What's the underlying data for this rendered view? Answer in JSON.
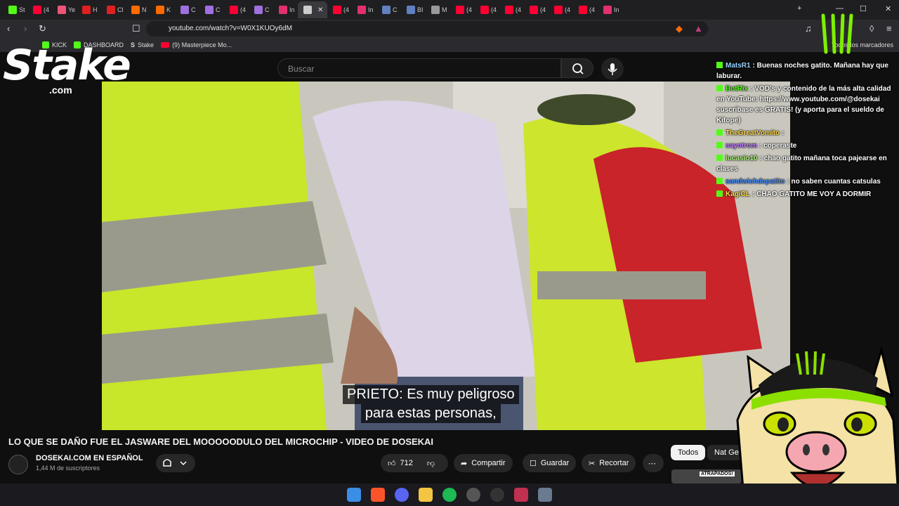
{
  "browser": {
    "tabs": [
      {
        "label": "St",
        "color": "#53fc18"
      },
      {
        "label": "(4",
        "color": "#ff0033"
      },
      {
        "label": "Ye",
        "color": "#ee5577"
      },
      {
        "label": "H",
        "color": "#e02020"
      },
      {
        "label": "Cl",
        "color": "#e02020"
      },
      {
        "label": "N",
        "color": "#ff6a00"
      },
      {
        "label": "K",
        "color": "#ff6a00"
      },
      {
        "label": "C",
        "color": "#a070e0"
      },
      {
        "label": "C",
        "color": "#a070e0"
      },
      {
        "label": "(4",
        "color": "#ff0033"
      },
      {
        "label": "C",
        "color": "#a070e0"
      },
      {
        "label": "In",
        "color": "#e1306c"
      },
      {
        "label": "",
        "color": "#cccccc",
        "active": true
      },
      {
        "label": "(4",
        "color": "#ff0033"
      },
      {
        "label": "In",
        "color": "#e1306c"
      },
      {
        "label": "C",
        "color": "#6080c0"
      },
      {
        "label": "BI",
        "color": "#6080c0"
      },
      {
        "label": "M",
        "color": "#999999"
      },
      {
        "label": "(4",
        "color": "#ff0033"
      },
      {
        "label": "(4",
        "color": "#ff0033"
      },
      {
        "label": "(4",
        "color": "#ff0033"
      },
      {
        "label": "(4",
        "color": "#ff0033"
      },
      {
        "label": "(4",
        "color": "#ff0033"
      },
      {
        "label": "(4",
        "color": "#ff0033"
      },
      {
        "label": "In",
        "color": "#e1306c"
      }
    ],
    "url": "youtube.com/watch?v=W0X1KUOy6dM",
    "bookmarks": [
      "KICK",
      "DASHBOARD",
      "Stake",
      "(9) Masterpiece Mo..."
    ],
    "all_bookmarks": "Todos los marcadores"
  },
  "youtube": {
    "search_placeholder": "Buscar",
    "subtitle_line1": "PRIETO: Es muy peligroso",
    "subtitle_line2": "para estas personas,",
    "title": "LO QUE SE DAÑO FUE EL JASWARE DEL MOOOOODULO DEL MICROCHIP - VIDEO DE DOSEKAI",
    "channel": "DOSEKAI.COM EN ESPAÑOL",
    "subscribers": "1,44 M de suscriptores",
    "likes": "712",
    "share": "Compartir",
    "save": "Guardar",
    "clip": "Recortar",
    "chip_all": "Todos",
    "chip_natgeo": "Nat Geo",
    "thumb_label": "ATRAPADOS!"
  },
  "overlay": {
    "stake": "Stake",
    "stake_com": ".com"
  },
  "chat": [
    {
      "user": "MatsR1",
      "color": "#9ad0ff",
      "text": ": Buenas noches gatito. Mañana hay que laburar."
    },
    {
      "user": "BotRix",
      "color": "#53fc18",
      "text": ": VOD's y contenido de la más alta calidad en YouTube: https://www.youtube.com/@dosekai suscribase es GRATIS! (y aporta para el sueldo de Kitope)"
    },
    {
      "user": "TheGreatVomito",
      "color": "#ffd84a",
      "text": ":"
    },
    {
      "user": "sayotrom",
      "color": "#c080ff",
      "text": ": coperaste"
    },
    {
      "user": "lucasio10",
      "color": "#b0f080",
      "text": ": chao gatito mañana toca pajearse en clases"
    },
    {
      "user": "sandwichdepatito",
      "color": "#4a90ff",
      "text": ": no saben cuantas catsulas"
    },
    {
      "user": "KagiCL",
      "color": "#ffe14a",
      "text": ": CHAO GATITO ME VOY A DORMIR"
    }
  ],
  "colors": {
    "kick_green": "#53fc18",
    "yt_bg": "#0f0f0f"
  }
}
